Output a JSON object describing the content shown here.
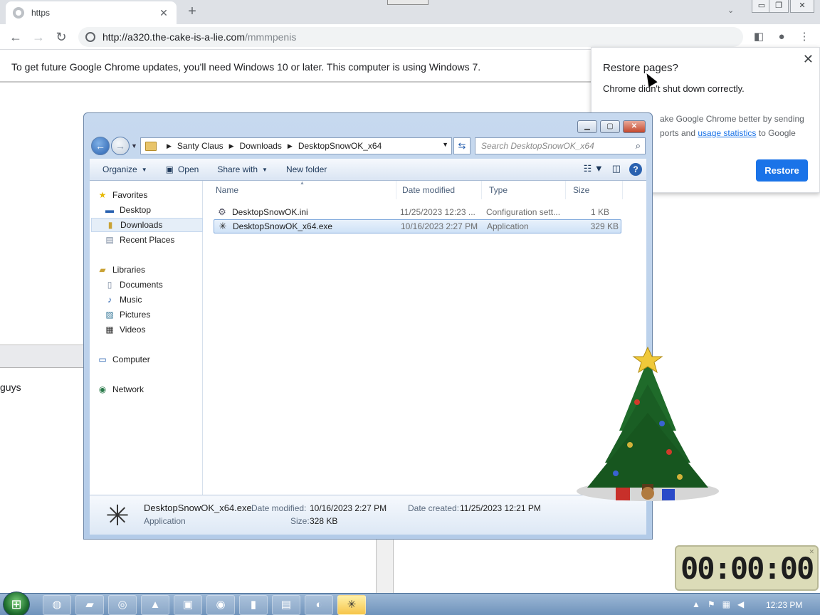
{
  "browser": {
    "tab_title": "https",
    "url_host": "http://a320.the-cake-is-a-lie.com",
    "url_path": "/mmmpenis",
    "infobar_text": "To get future Google Chrome updates, you'll need Windows 10 or later. This computer is using Windows 7."
  },
  "restore_popup": {
    "title": "Restore pages?",
    "message": "Chrome didn't shut down correctly.",
    "help_prefix": "ake Google Chrome better by sending",
    "help_mid": "ports and ",
    "help_link": "usage statistics",
    "help_suffix": " to Google",
    "restore_button": "Restore"
  },
  "background_text": {
    "left_word": "guys"
  },
  "explorer": {
    "address": {
      "segments": [
        "Santy Claus",
        "Downloads",
        "DesktopSnowOK_x64"
      ]
    },
    "search_placeholder": "Search DesktopSnowOK_x64",
    "commands": {
      "organize": "Organize",
      "open": "Open",
      "share_with": "Share with",
      "new_folder": "New folder"
    },
    "nav": {
      "favorites": "Favorites",
      "desktop": "Desktop",
      "downloads": "Downloads",
      "recent_places": "Recent Places",
      "libraries": "Libraries",
      "documents": "Documents",
      "music": "Music",
      "pictures": "Pictures",
      "videos": "Videos",
      "computer": "Computer",
      "network": "Network"
    },
    "columns": {
      "name": "Name",
      "date_modified": "Date modified",
      "type": "Type",
      "size": "Size"
    },
    "files": [
      {
        "name": "DesktopSnowOK.ini",
        "date": "11/25/2023 12:23 ...",
        "type": "Configuration sett...",
        "size": "1 KB"
      },
      {
        "name": "DesktopSnowOK_x64.exe",
        "date": "10/16/2023 2:27 PM",
        "type": "Application",
        "size": "329 KB"
      }
    ],
    "details": {
      "filename": "DesktopSnowOK_x64.exe",
      "kind": "Application",
      "date_modified_label": "Date modified:",
      "date_modified": "10/16/2023 2:27 PM",
      "date_created_label": "Date created:",
      "date_created": "11/25/2023 12:21 PM",
      "size_label": "Size:",
      "size": "328 KB"
    }
  },
  "clock_widget": {
    "digits": "00:00:00"
  },
  "taskbar": {
    "time": "12:23 PM"
  }
}
